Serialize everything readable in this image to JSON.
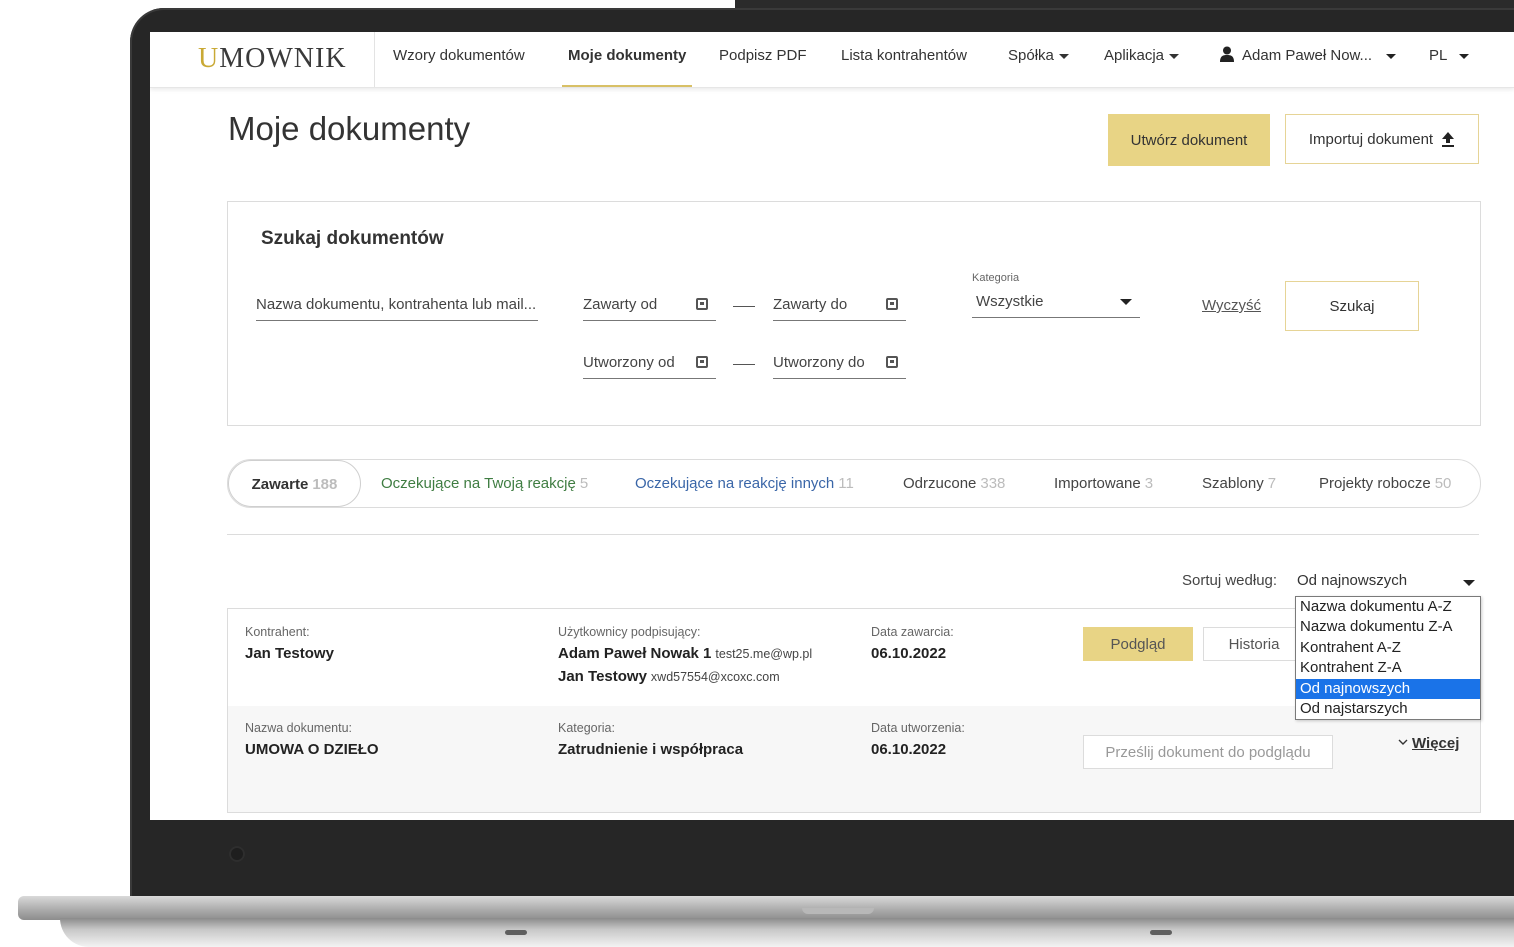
{
  "nav": {
    "logo_mark": "U",
    "logo_text": "MOWNIK",
    "items": [
      "Wzory dokumentów",
      "Moje dokumenty",
      "Podpisz PDF",
      "Lista kontrahentów",
      "Spółka",
      "Aplikacja"
    ],
    "user": "Adam Paweł Now...",
    "lang": "PL"
  },
  "page": {
    "title": "Moje dokumenty",
    "create_button": "Utwórz dokument",
    "import_button": "Importuj dokument"
  },
  "search": {
    "title": "Szukaj dokumentów",
    "name_placeholder": "Nazwa dokumentu, kontrahenta lub mail...",
    "concluded_from": "Zawarty od",
    "concluded_to": "Zawarty do",
    "created_from": "Utworzony od",
    "created_to": "Utworzony do",
    "category_label": "Kategoria",
    "category_value": "Wszystkie",
    "clear": "Wyczyść",
    "submit": "Szukaj"
  },
  "tabs": [
    {
      "label": "Zawarte",
      "count": "188"
    },
    {
      "label": "Oczekujące na Twoją reakcję",
      "count": "5"
    },
    {
      "label": "Oczekujące na reakcję innych",
      "count": "11"
    },
    {
      "label": "Odrzucone",
      "count": "338"
    },
    {
      "label": "Importowane",
      "count": "3"
    },
    {
      "label": "Szablony",
      "count": "7"
    },
    {
      "label": "Projekty robocze",
      "count": "50"
    }
  ],
  "sort": {
    "label": "Sortuj według:",
    "selected": "Od najnowszych",
    "options": [
      "Nazwa dokumentu A-Z",
      "Nazwa dokumentu Z-A",
      "Kontrahent A-Z",
      "Kontrahent Z-A",
      "Od najnowszych",
      "Od najstarszych"
    ]
  },
  "document": {
    "contractor_label": "Kontrahent:",
    "contractor": "Jan Testowy",
    "signers_label": "Użytkownicy podpisujący:",
    "signers": [
      {
        "name": "Adam Paweł Nowak 1",
        "email": "test25.me@wp.pl"
      },
      {
        "name": "Jan Testowy",
        "email": "xwd57554@xcoxc.com"
      }
    ],
    "concluded_label": "Data zawarcia:",
    "concluded": "06.10.2022",
    "name_label": "Nazwa dokumentu:",
    "name": "UMOWA O DZIEŁO",
    "category_label": "Kategoria:",
    "category": "Zatrudnienie i współpraca",
    "created_label": "Data utworzenia:",
    "created": "06.10.2022",
    "preview_button": "Podgląd",
    "history_button": "Historia",
    "send_button": "Prześlij dokument do podglądu",
    "more": "Więcej"
  },
  "colors": {
    "accent": "#e8d485",
    "green_tab": "#3f7d42",
    "blue_tab": "#3a66a8",
    "dropdown_selected": "#1a73e8"
  }
}
